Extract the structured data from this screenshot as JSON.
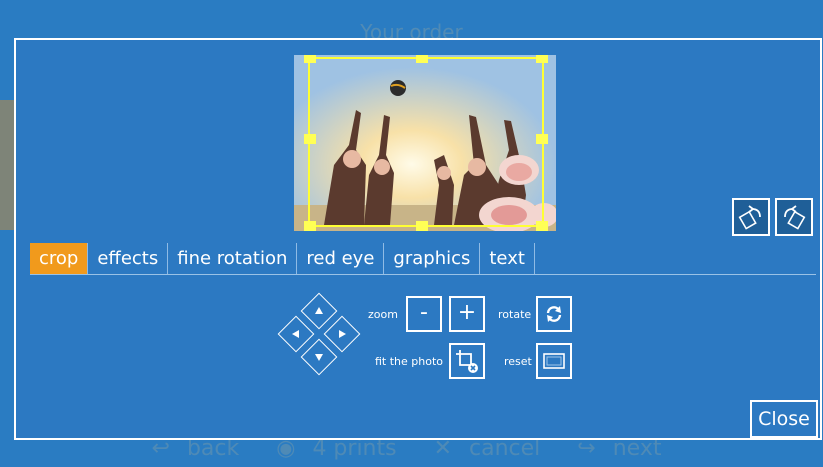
{
  "background": {
    "title": "Your order",
    "footer": {
      "back_label": "back",
      "prints_label": "4 prints",
      "cancel_label": "cancel",
      "next_label": "next"
    }
  },
  "editor": {
    "tabs": [
      {
        "label": "crop",
        "active": true
      },
      {
        "label": "effects",
        "active": false
      },
      {
        "label": "fine rotation",
        "active": false
      },
      {
        "label": "red eye",
        "active": false
      },
      {
        "label": "graphics",
        "active": false
      },
      {
        "label": "text",
        "active": false
      }
    ],
    "controls": {
      "zoom_label": "zoom",
      "zoom_minus": "-",
      "zoom_plus": "+",
      "rotate_label": "rotate",
      "fit_label": "fit the photo",
      "reset_label": "reset"
    },
    "close_label": "Close"
  },
  "colors": {
    "accent": "#f19a1c",
    "panel": "#2c79c2",
    "crop_frame": "#ffff33"
  }
}
